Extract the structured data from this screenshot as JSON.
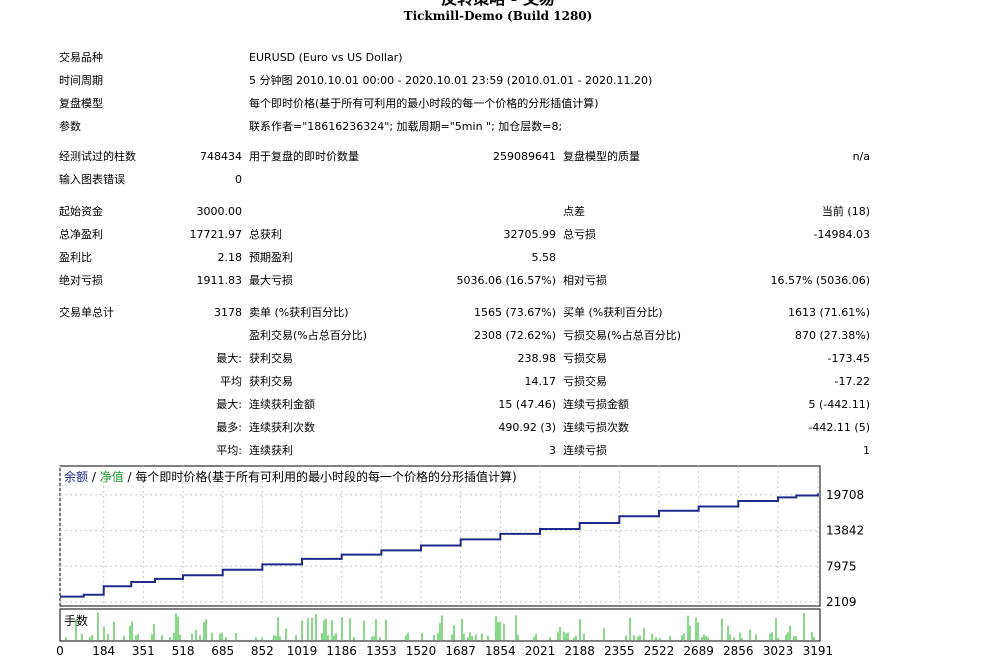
{
  "header": {
    "title": "反转策略 - 交易",
    "subtitle": "Tickmill-Demo (Build 1280)"
  },
  "info": {
    "symbol": {
      "label": "交易品种",
      "value": "EURUSD (Euro vs US Dollar)"
    },
    "period": {
      "label": "时间周期",
      "value": "5 分钟图 2010.10.01 00:00 - 2020.10.01 23:59 (2010.01.01 - 2020.11.20)"
    },
    "model": {
      "label": "复盘模型",
      "value": "每个即时价格(基于所有可利用的最小时段的每一个价格的分形插值计算)"
    },
    "params": {
      "label": "参数",
      "value": "联系作者=\"18616236324\"; 加载周期=\"5min \"; 加仓层数=8;"
    }
  },
  "stats": {
    "bars_tested": {
      "label": "经测试过的柱数",
      "value": "748434"
    },
    "ticks_modelled": {
      "label": "用于复盘的即时价数量",
      "value": "259089641"
    },
    "model_quality": {
      "label": "复盘模型的质量",
      "value": "n/a"
    },
    "mismatch_errors": {
      "label": "输入图表错误",
      "value": "0"
    },
    "initial_deposit": {
      "label": "起始资金",
      "value": "3000.00"
    },
    "spread": {
      "label": "点差",
      "value": "当前 (18)"
    },
    "total_net_profit": {
      "label": "总净盈利",
      "value": "17721.97"
    },
    "gross_profit": {
      "label": "总获利",
      "value": "32705.99"
    },
    "gross_loss": {
      "label": "总亏损",
      "value": "-14984.03"
    },
    "profit_factor": {
      "label": "盈利比",
      "value": "2.18"
    },
    "expected_payoff": {
      "label": "预期盈利",
      "value": "5.58"
    },
    "abs_drawdown": {
      "label": "绝对亏损",
      "value": "1911.83"
    },
    "max_drawdown": {
      "label": "最大亏损",
      "value": "5036.06 (16.57%)"
    },
    "rel_drawdown": {
      "label": "相对亏损",
      "value": "16.57% (5036.06)"
    },
    "total_trades": {
      "label": "交易单总计",
      "value": "3178"
    },
    "short_positions": {
      "label": "卖单 (%获利百分比)",
      "value": "1565 (73.67%)"
    },
    "long_positions": {
      "label": "买单 (%获利百分比)",
      "value": "1613 (71.61%)"
    },
    "profit_trades": {
      "label": "盈利交易(%占总百分比)",
      "value": "2308 (72.62%)"
    },
    "loss_trades": {
      "label": "亏损交易(%占总百分比)",
      "value": "870 (27.38%)"
    },
    "largest_prefix": "最大:",
    "largest_profit": {
      "label": "获利交易",
      "value": "238.98"
    },
    "largest_loss": {
      "label": "亏损交易",
      "value": "-173.45"
    },
    "average_prefix": "平均",
    "average_profit": {
      "label": "获利交易",
      "value": "14.17"
    },
    "average_loss": {
      "label": "亏损交易",
      "value": "-17.22"
    },
    "max_consec_prefix": "最大:",
    "max_consec_wins_money": {
      "label": "连续获利金额",
      "value": "15 (47.46)"
    },
    "max_consec_losses_money": {
      "label": "连续亏损金额",
      "value": "5 (-442.11)"
    },
    "maximal_prefix": "最多:",
    "maximal_consec_profit": {
      "label": "连续获利次数",
      "value": "490.92 (3)"
    },
    "maximal_consec_loss": {
      "label": "连续亏损次数",
      "value": "-442.11 (5)"
    },
    "avg_consec_prefix": "平均:",
    "avg_consec_wins": {
      "label": "连续获利",
      "value": "3"
    },
    "avg_consec_losses": {
      "label": "连续亏损",
      "value": "1"
    }
  },
  "chart_legend": {
    "balance": "余额",
    "separator": " / ",
    "equity": "净值",
    "rest": " / 每个即时价格(基于所有可利用的最小时段的每一个价格的分形插值计算)"
  },
  "colors": {
    "balance": "#1f2a8c",
    "equity": "#1b9a2e",
    "volume": "#15b315",
    "grid": "#c8c8c8"
  },
  "chart_data": [
    {
      "type": "line",
      "title": "",
      "series": [
        {
          "name": "余额",
          "x": [
            0,
            100,
            184,
            300,
            400,
            518,
            685,
            852,
            1019,
            1186,
            1353,
            1520,
            1687,
            1854,
            2021,
            2188,
            2355,
            2522,
            2689,
            2856,
            3023,
            3100,
            3191
          ],
          "values": [
            3000,
            3300,
            4700,
            5400,
            5900,
            6500,
            7400,
            8300,
            9200,
            9900,
            10600,
            11400,
            12400,
            13300,
            14100,
            15100,
            16200,
            17100,
            17800,
            18700,
            19300,
            19600,
            19950
          ]
        }
      ],
      "yticks": [
        "2109",
        "7975",
        "13842",
        "19708"
      ],
      "ylim": [
        2109,
        21500
      ],
      "xlim": [
        0,
        3200
      ]
    },
    {
      "type": "bar",
      "title": "手数",
      "xticks": [
        "0",
        "184",
        "351",
        "518",
        "685",
        "852",
        "1019",
        "1186",
        "1353",
        "1520",
        "1687",
        "1854",
        "2021",
        "2188",
        "2355",
        "2522",
        "2689",
        "2856",
        "3023",
        "3191"
      ],
      "xlim": [
        0,
        3200
      ],
      "note": "lot size per trade, varies between about 0.1 and 1.0"
    }
  ]
}
